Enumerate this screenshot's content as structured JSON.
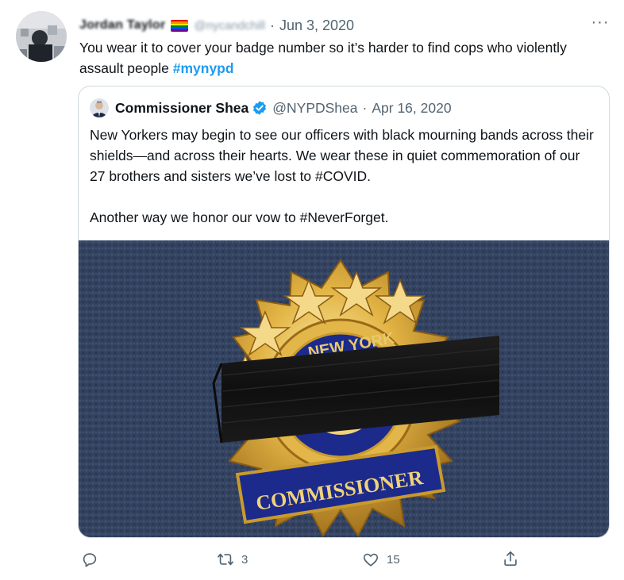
{
  "tweet": {
    "author_name": "Jordan Taylor",
    "author_handle": "@nycandchill",
    "separator": "·",
    "date": "Jun 3, 2020",
    "more_label": "···",
    "text_main": "You wear it to cover your badge number so it’s harder to find cops who violently assault people ",
    "hashtag": "#mynypd"
  },
  "quoted_tweet": {
    "author_name": "Commissioner Shea",
    "author_handle": "@NYPDShea",
    "separator": "·",
    "date": "Apr 16, 2020",
    "text": "New Yorkers may begin to see our officers with black mourning bands across their shields—and across their hearts. We wear these in quiet commemoration of our 27 brothers and sisters we’ve lost to #COVID.\n\nAnother way we honor our vow to #NeverForget.",
    "image_badge_top": "NEW YORK",
    "image_badge_banner": "COMMISSIONER"
  },
  "actions": {
    "reply_icon": "reply-icon",
    "retweet_icon": "retweet-icon",
    "retweet_count": "3",
    "like_icon": "like-icon",
    "like_count": "15",
    "share_icon": "share-icon"
  },
  "colors": {
    "accent": "#1d9bf0",
    "secondary_text": "#536471",
    "border": "#cfd9de",
    "badge_gold": "#d8a93a",
    "badge_blue": "#1c2a8c",
    "carpet": "#2e3c5a"
  }
}
